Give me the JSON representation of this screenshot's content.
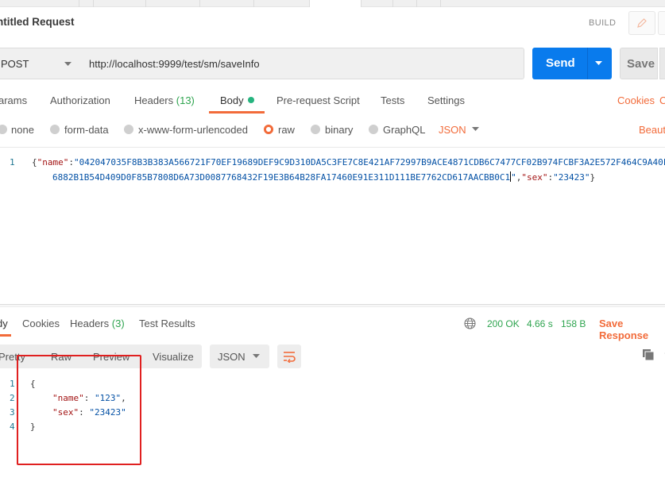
{
  "request": {
    "title": "ntitled Request",
    "build_label": "BUILD",
    "method": "POST",
    "url": "http://localhost:9999/test/sm/saveInfo",
    "send_label": "Send",
    "save_label": "Save"
  },
  "request_tabs": {
    "params": "arams",
    "authorization": "Authorization",
    "headers": "Headers",
    "headers_count": "(13)",
    "body": "Body",
    "prerequest": "Pre-request Script",
    "tests": "Tests",
    "settings": "Settings",
    "cookies": "Cookies",
    "code": "C"
  },
  "body_types": {
    "none": "none",
    "form_data": "form-data",
    "urlencoded": "x-www-form-urlencoded",
    "raw": "raw",
    "binary": "binary",
    "graphql": "GraphQL",
    "format": "JSON",
    "beautify": "Beaut"
  },
  "editor": {
    "line1_number": "1",
    "line1_open": "{",
    "key_name": "\"name\"",
    "colon": ":",
    "value_part1": "\"042047035F8B3B383A566721F70EF19689DEF9C9D310DA5C3FE7C8E421AF72997B9ACE4871CDB6C7477CF02B974FCBF3A2E572F464C9A40F",
    "value_part2": "6882B1B54D409D0F85B7808D6A73D0087768432F19E3B64B28FA17460E91E311D111BE7762CD617AACBB0C1",
    "value_close": "\"",
    "comma": ",",
    "key_sex": "\"sex\"",
    "value_sex": "\"23423\"",
    "close": "}"
  },
  "response_tabs": {
    "body": "dy",
    "cookies": "Cookies",
    "headers": "Headers",
    "headers_count": "(3)",
    "test_results": "Test Results",
    "status": "200 OK",
    "time": "4.66 s",
    "size": "158 B",
    "save_response": "Save Response"
  },
  "response_toolbar": {
    "pretty": "Pretty",
    "raw": "Raw",
    "preview": "Preview",
    "visualize": "Visualize",
    "format": "JSON"
  },
  "response_body": {
    "line_numbers": [
      "1",
      "2",
      "3",
      "4"
    ],
    "open": "{",
    "name_key": "\"name\"",
    "name_value": "\"123\"",
    "sex_key": "\"sex\"",
    "sex_value": "\"23423\"",
    "close": "}"
  },
  "colors": {
    "accent_orange": "#f26b3a",
    "send_blue": "#097bed",
    "status_green": "#2ea44f",
    "annotation_red": "#e02020"
  }
}
